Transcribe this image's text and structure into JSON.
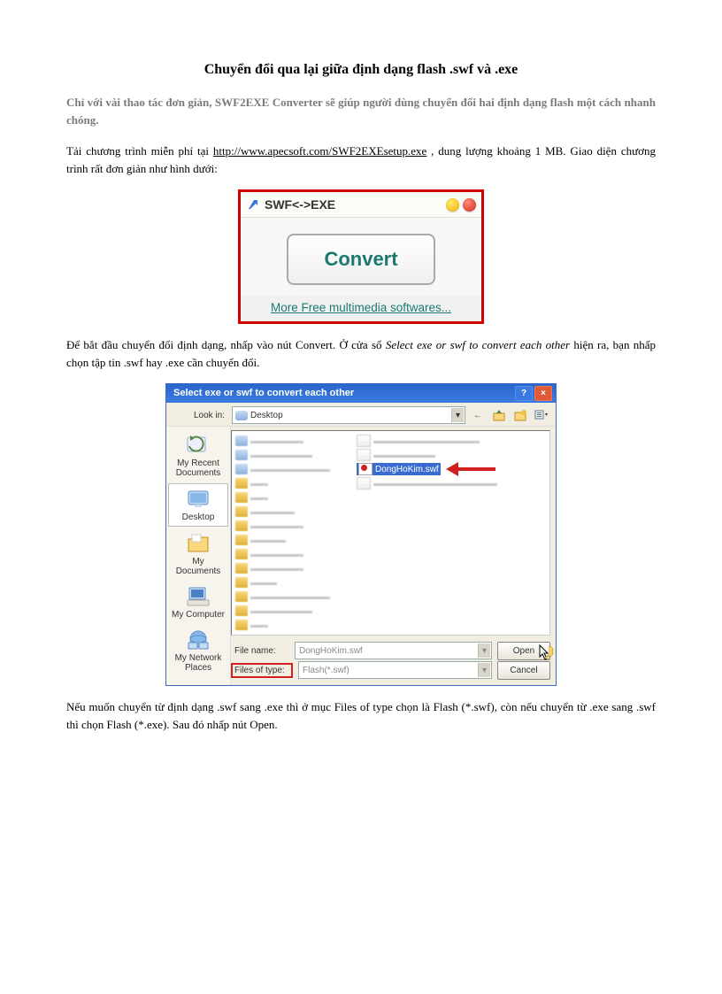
{
  "title": "Chuyển đổi qua lại giữa định dạng flash .swf và .exe",
  "intro": "Chỉ với vài thao tác đơn giản, SWF2EXE Converter sẽ giúp người dùng chuyển đổi hai định dạng flash một cách nhanh chóng.",
  "para1_prefix": "Tải chương trình miễn phí tại ",
  "para1_link": "http://www.apecsoft.com/SWF2EXEsetup.exe",
  "para1_suffix": " , dung lượng khoảng 1 MB. Giao diện chương trình rất đơn giản như hình dưới:",
  "shot1": {
    "title": "SWF<->EXE",
    "button": "Convert",
    "footer": "More Free multimedia softwares..."
  },
  "para2_a": "Để bắt đầu chuyển đổi định dạng, nhấp vào nút Convert. Ở cửa sổ ",
  "para2_b": "Select exe or swf to convert each other",
  "para2_c": " hiện ra, bạn nhấp chọn tập tin .swf hay .exe cần chuyển đổi.",
  "shot2": {
    "title": "Select exe or swf to convert each other",
    "look_in_label": "Look in:",
    "look_in_value": "Desktop",
    "places": {
      "recent": "My Recent Documents",
      "desktop": "Desktop",
      "mydocs": "My Documents",
      "mycomputer": "My Computer",
      "network": "My Network Places"
    },
    "selected_file": "DongHoKim.swf",
    "file_name_label": "File name:",
    "file_name_value": "DongHoKim.swf",
    "file_type_label": "Files of type:",
    "file_type_value": "Flash(*.swf)",
    "open": "Open",
    "cancel": "Cancel"
  },
  "para3": "Nếu muốn chuyển từ định dạng .swf sang .exe thì ở mục Files of type chọn là Flash (*.swf), còn nếu chuyển từ .exe sang .swf thì chọn Flash (*.exe). Sau đó nhấp nút Open."
}
